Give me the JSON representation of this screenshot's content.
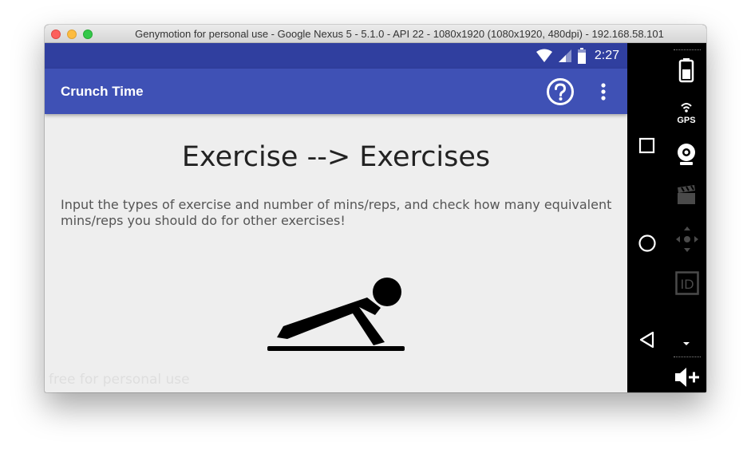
{
  "window": {
    "title": "Genymotion for personal use - Google Nexus 5 - 5.1.0 - API 22 - 1080x1920 (1080x1920, 480dpi) - 192.168.58.101"
  },
  "statusbar": {
    "time": "2:27",
    "icons": [
      "wifi-icon",
      "cell-signal-icon",
      "battery-icon"
    ]
  },
  "appbar": {
    "title": "Crunch Time",
    "actions": [
      "help-icon",
      "overflow-menu-icon"
    ],
    "color": "#3f51b5",
    "status_color": "#303f9f"
  },
  "main": {
    "headline": "Exercise --> Exercises",
    "description": "Input the types of exercise and number of mins/reps, and check how many equivalent mins/reps you should do for other exercises!",
    "illustration": "pushup-icon"
  },
  "watermark": "free for personal use",
  "sidebar": {
    "nav": [
      "recent-apps-icon",
      "home-icon",
      "back-icon"
    ],
    "tools": [
      "battery-icon",
      "gps-icon",
      "webcam-icon",
      "video-capture-icon",
      "dpad-icon",
      "device-id-icon",
      "volume-up-icon"
    ],
    "gps_label": "GPS",
    "id_label": "ID"
  }
}
